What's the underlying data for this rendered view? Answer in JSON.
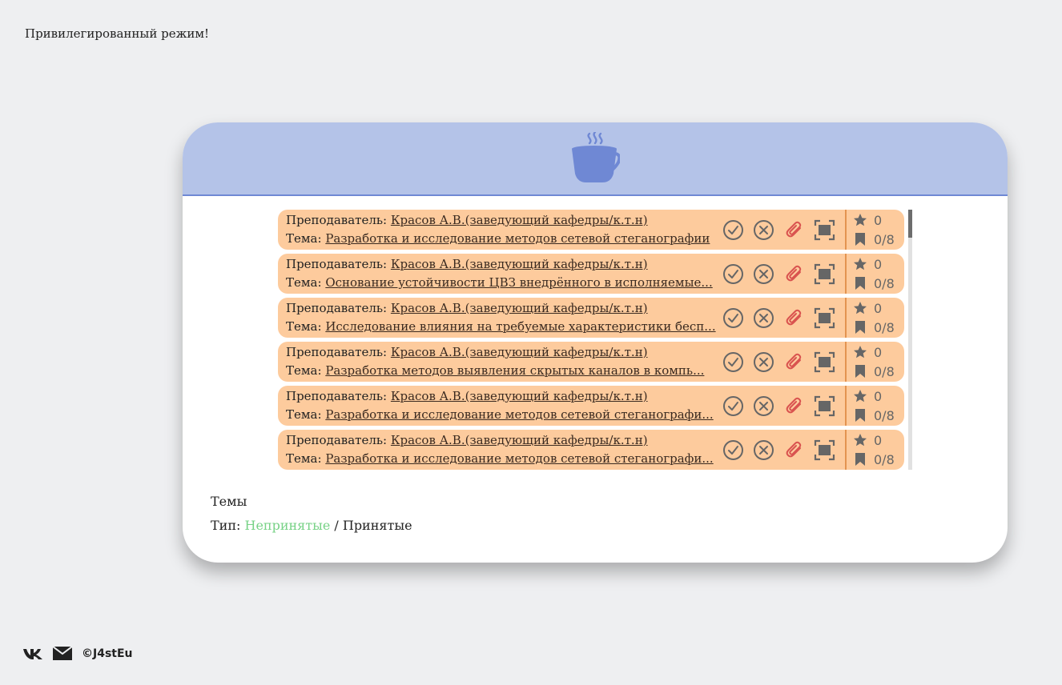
{
  "notice": "Привилегированный режим!",
  "colors": {
    "header_bg": "#b4c3e8",
    "accent": "#6f88d4",
    "item_bg": "#fdcb9d",
    "active_type": "#77d286",
    "attach_icon": "#d9534f"
  },
  "header": {
    "icon": "coffee-cup-icon"
  },
  "items": [
    {
      "teacher_label": "Преподаватель:",
      "teacher": "Красов А.В.(заведующий кафедры/к.т.н)",
      "topic_label": "Тема:",
      "topic": "Разработка и исследование методов сетевой стеганографии",
      "stars": "0",
      "bookmarks": "0/8"
    },
    {
      "teacher_label": "Преподаватель:",
      "teacher": "Красов А.В.(заведующий кафедры/к.т.н)",
      "topic_label": "Тема:",
      "topic": "Основание устойчивости ЦВЗ внедрённого в исполняемые...",
      "stars": "0",
      "bookmarks": "0/8"
    },
    {
      "teacher_label": "Преподаватель:",
      "teacher": "Красов А.В.(заведующий кафедры/к.т.н)",
      "topic_label": "Тема:",
      "topic": "Исследование влияния на требуемые характеристики бесп...",
      "stars": "0",
      "bookmarks": "0/8"
    },
    {
      "teacher_label": "Преподаватель:",
      "teacher": "Красов А.В.(заведующий кафедры/к.т.н)",
      "topic_label": "Тема:",
      "topic": "Разработка методов выявления скрытых каналов в компь...",
      "stars": "0",
      "bookmarks": "0/8"
    },
    {
      "teacher_label": "Преподаватель:",
      "teacher": "Красов А.В.(заведующий кафедры/к.т.н)",
      "topic_label": "Тема:",
      "topic": "Разработка и исследование методов сетевой стеганографи...",
      "stars": "0",
      "bookmarks": "0/8"
    },
    {
      "teacher_label": "Преподаватель:",
      "teacher": "Красов А.В.(заведующий кафедры/к.т.н)",
      "topic_label": "Тема:",
      "topic": "Разработка и исследование методов сетевой стеганографи...",
      "stars": "0",
      "bookmarks": "0/8"
    }
  ],
  "item_actions": [
    "accept-icon",
    "reject-icon",
    "attachment-icon",
    "fullscreen-icon"
  ],
  "section": {
    "title": "Темы",
    "type_label": "Тип:",
    "type_unaccepted": "Непринятые",
    "type_separator": " / ",
    "type_accepted": "Принятые"
  },
  "footer": {
    "icons": [
      "vk-icon",
      "mail-icon"
    ],
    "copyright": "©J4stEu"
  }
}
